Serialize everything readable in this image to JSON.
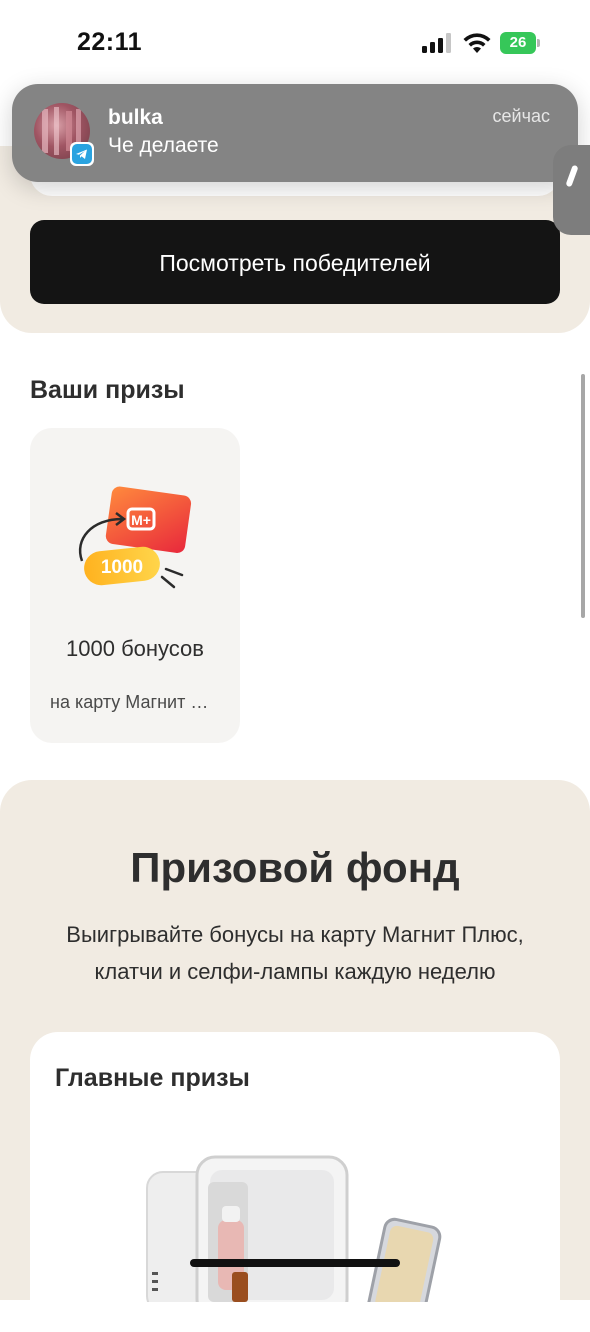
{
  "status_bar": {
    "time": "22:11",
    "battery": "26"
  },
  "notification": {
    "sender": "bulka",
    "message": "Че делаете",
    "time": "сейчас",
    "app_icon": "telegram-icon"
  },
  "winners_button": {
    "label": "Посмотреть победителей"
  },
  "your_prizes": {
    "title": "Ваши призы",
    "items": [
      {
        "badge": "1000",
        "name": "1000 бонусов",
        "subtitle": "на карту Магнит Плюс",
        "logo": "М+"
      }
    ]
  },
  "prize_fund": {
    "title": "Призовой фонд",
    "description": "Выигрывайте бонусы на карту Магнит Плюс, клатчи и селфи-лампы каждую неделю",
    "main_prizes": {
      "title": "Главные призы"
    }
  },
  "colors": {
    "accent_dark": "#141414",
    "beige": "#f1ebe2",
    "card_bg": "#f5f4f2",
    "battery_green": "#36c759",
    "telegram_blue": "#2aa3e0"
  }
}
